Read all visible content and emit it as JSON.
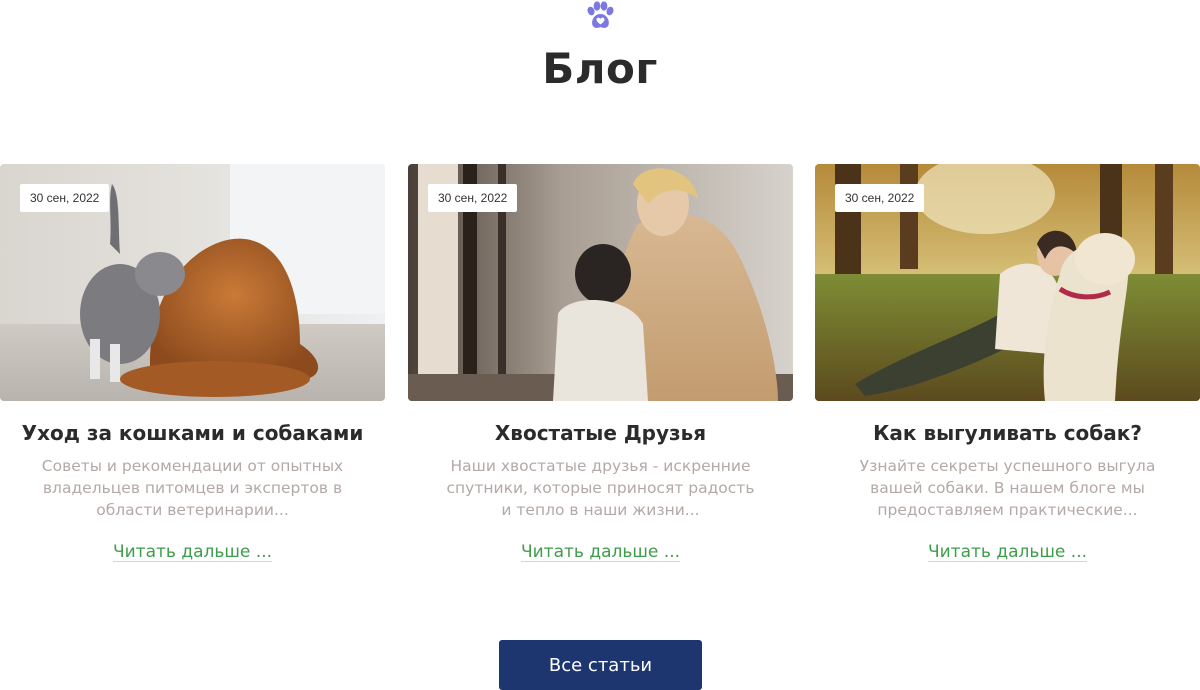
{
  "header": {
    "logo_icon": "paw-heart-icon",
    "title": "Блог"
  },
  "posts": [
    {
      "date": "30 сен, 2022",
      "title": "Уход за кошками и собаками",
      "description": "Советы и рекомендации от опытных владельцев питомцев и экспертов в области ветеринарии...",
      "read_more": "Читать дальше ...",
      "image": "cat-and-dog-photo"
    },
    {
      "date": "30 сен, 2022",
      "title": "Хвостатые Друзья",
      "description": "Наши хвостатые друзья - искренние спутники, которые приносят радость и тепло в наши жизни...",
      "read_more": "Читать дальше ...",
      "image": "woman-with-dog-photo"
    },
    {
      "date": "30 сен, 2022",
      "title": "Как выгуливать собак?",
      "description": "Узнайте секреты успешного выгула вашей собаки. В нашем блоге мы предоставляем практические...",
      "read_more": "Читать дальше ...",
      "image": "woman-with-dog-in-park-photo"
    }
  ],
  "footer": {
    "all_posts_label": "Все статьи"
  },
  "colors": {
    "accent": "#7b79e0",
    "link": "#3e9d4a",
    "button": "#1e3670",
    "muted_text": "#b3a9a6"
  }
}
